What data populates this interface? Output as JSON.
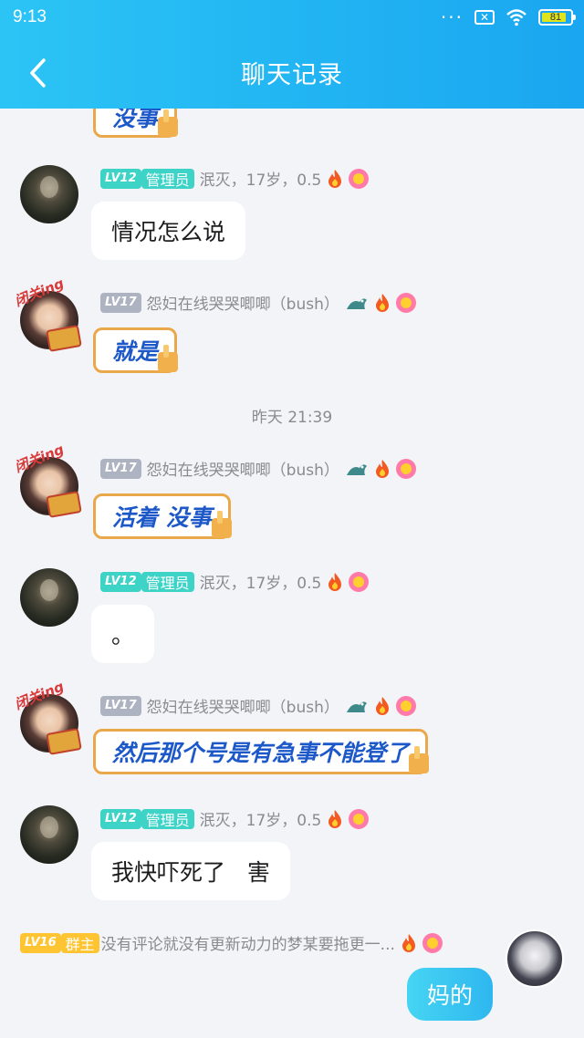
{
  "status_bar": {
    "time": "9:13",
    "battery": "81"
  },
  "header": {
    "title": "聊天记录"
  },
  "messages": [
    {
      "sender": "",
      "text": "没事"
    },
    {
      "level": "LV12",
      "role": "管理员",
      "meta": "泯灭，17岁，0.5",
      "text": "情况怎么说"
    },
    {
      "level": "LV17",
      "meta": "怨妇在线哭哭唧唧（bush）",
      "text": "就是",
      "avatar_tag": "闭关ing"
    },
    {
      "timestamp": "昨天 21:39"
    },
    {
      "level": "LV17",
      "meta": "怨妇在线哭哭唧唧（bush）",
      "text": "活着 没事",
      "avatar_tag": "闭关ing"
    },
    {
      "level": "LV12",
      "role": "管理员",
      "meta": "泯灭，17岁，0.5",
      "text": "。"
    },
    {
      "level": "LV17",
      "meta": "怨妇在线哭哭唧唧（bush）",
      "text": "然后那个号是有急事不能登了",
      "avatar_tag": "闭关ing"
    },
    {
      "level": "LV12",
      "role": "管理员",
      "meta": "泯灭，17岁，0.5",
      "text": "我快吓死了   害"
    },
    {
      "level": "LV16",
      "role": "群主",
      "meta": "没有评论就没有更新动力的梦某要拖更一...",
      "text": "妈的"
    }
  ],
  "icons": {
    "back": "chevron-left-icon",
    "fire": "fire-icon",
    "flower": "flower-badge-icon",
    "dragon": "dragon-badge-icon"
  },
  "colors": {
    "header_start": "#2cc4f5",
    "header_end": "#1aa6f0",
    "lv_green": "#3dd3c7",
    "lv_gray": "#aeb3c2",
    "lv_yellow": "#ffc431",
    "special_text": "#1d58c8"
  }
}
